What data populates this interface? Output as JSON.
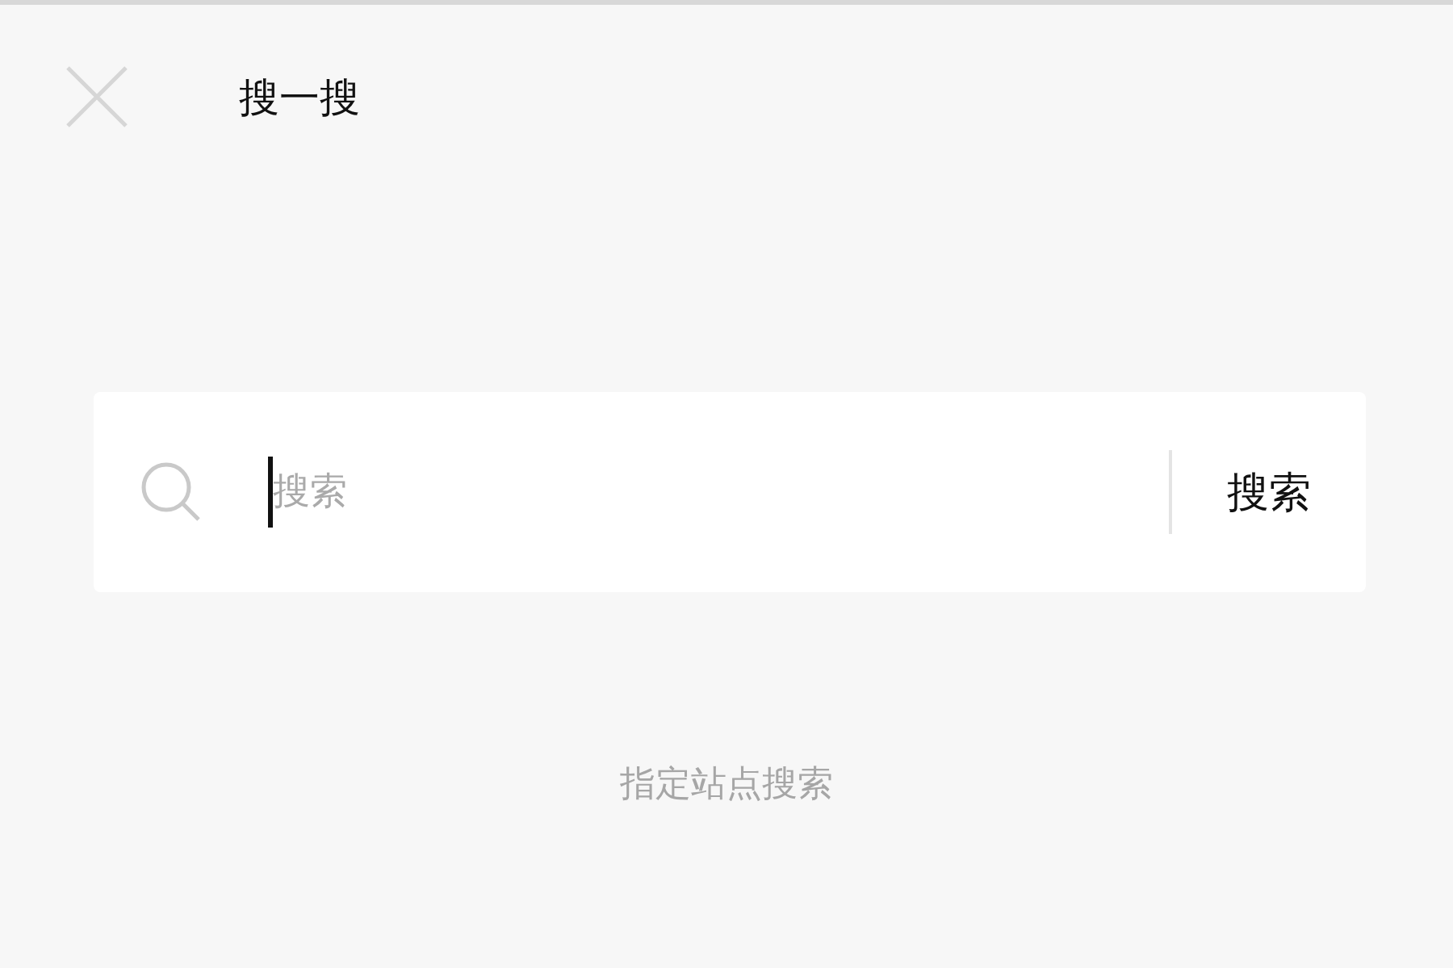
{
  "header": {
    "title": "搜一搜"
  },
  "search": {
    "placeholder": "搜索",
    "button": "搜索",
    "focused": true
  },
  "hint": "指定站点搜索"
}
